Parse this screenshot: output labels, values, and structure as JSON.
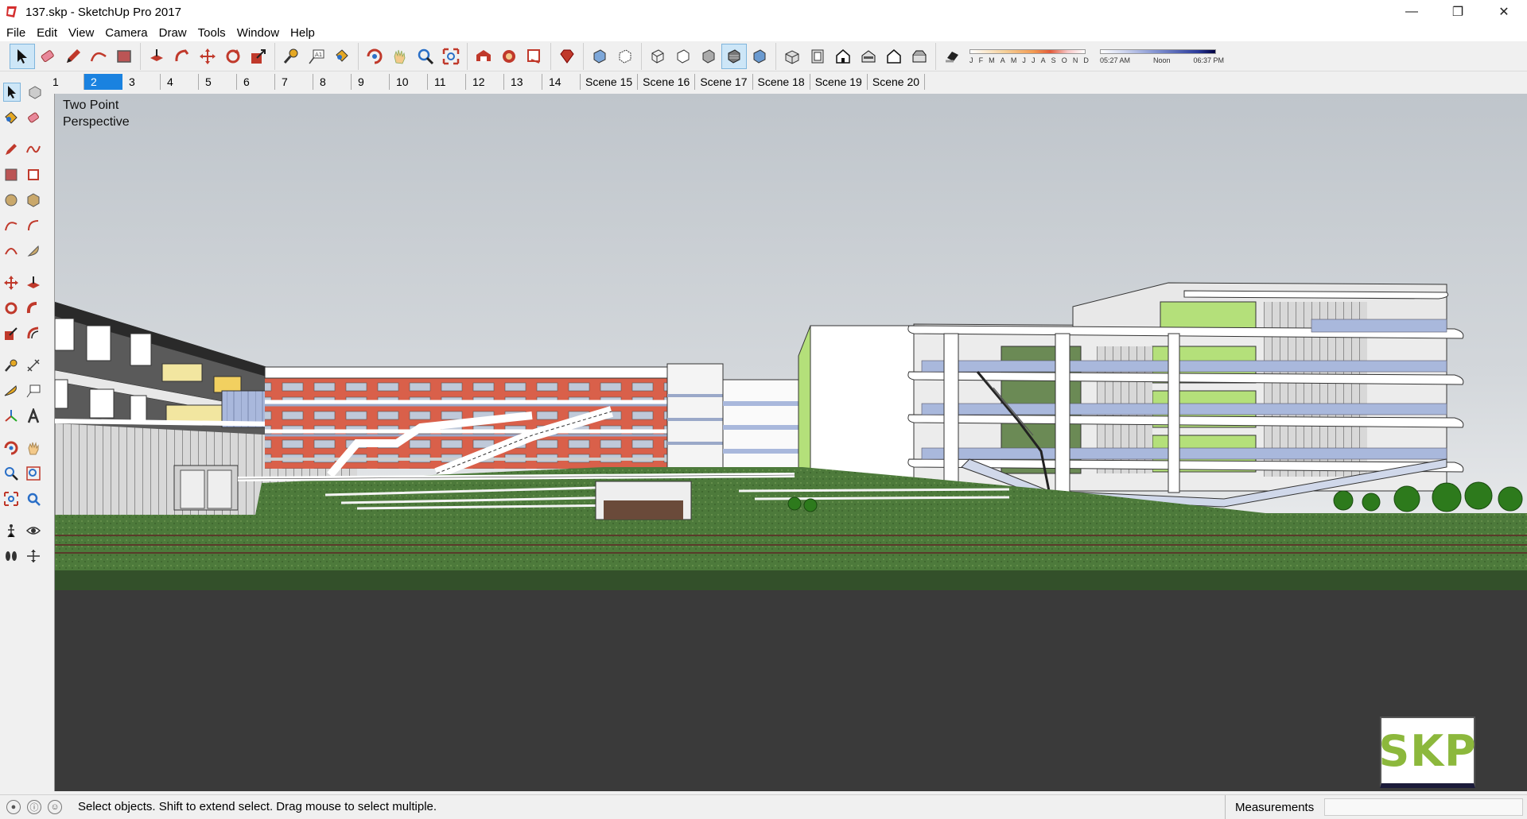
{
  "window": {
    "title": "137.skp - SketchUp Pro 2017",
    "controls": [
      "minimize-icon",
      "restore-icon",
      "close-icon"
    ]
  },
  "menu": [
    "File",
    "Edit",
    "View",
    "Camera",
    "Draw",
    "Tools",
    "Window",
    "Help"
  ],
  "toolbar": {
    "icons": [
      "select-icon",
      "eraser-icon",
      "pencil-icon",
      "arc-icon",
      "rectangle-icon",
      "push-pull-icon",
      "follow-me-icon",
      "move-icon",
      "rotate-icon",
      "scale-icon",
      "tape-measure-icon",
      "text-icon",
      "paint-bucket-icon",
      "orbit-icon",
      "pan-icon",
      "zoom-icon",
      "zoom-extents-icon",
      "warehouse-icon",
      "extension-icon",
      "layout-icon",
      "ruby-icon",
      "xray-icon",
      "back-edges-icon",
      "wireframe-icon",
      "hidden-line-icon",
      "shaded-icon",
      "shaded-textures-icon",
      "monochrome-icon",
      "iso-view-icon",
      "top-view-icon",
      "front-view-icon",
      "right-view-icon",
      "back-view-icon",
      "left-view-icon",
      "shadows-icon"
    ],
    "shadow_months": [
      "J",
      "F",
      "M",
      "A",
      "M",
      "J",
      "J",
      "A",
      "S",
      "O",
      "N",
      "D"
    ],
    "shadow_times": [
      "05:27 AM",
      "Noon",
      "06:37 PM"
    ]
  },
  "scenes": {
    "active_index": 1,
    "tabs": [
      "1",
      "2",
      "3",
      "4",
      "5",
      "6",
      "7",
      "8",
      "9",
      "10",
      "11",
      "12",
      "13",
      "14",
      "Scene 15",
      "Scene 16",
      "Scene 17",
      "Scene 18",
      "Scene 19",
      "Scene 20"
    ]
  },
  "viewport": {
    "camera_line1": "Two Point",
    "camera_line2": "Perspective",
    "watermark": "SKP"
  },
  "status": {
    "hint": "Select objects. Shift to extend select. Drag mouse to select multiple.",
    "measurements_label": "Measurements",
    "measurements_value": ""
  },
  "colors": {
    "accent": "#1a82e0",
    "brick": "#d9604a",
    "lime": "#b4e07a",
    "glass": "#9fb1d8",
    "lawn": "#4a7a3a"
  }
}
